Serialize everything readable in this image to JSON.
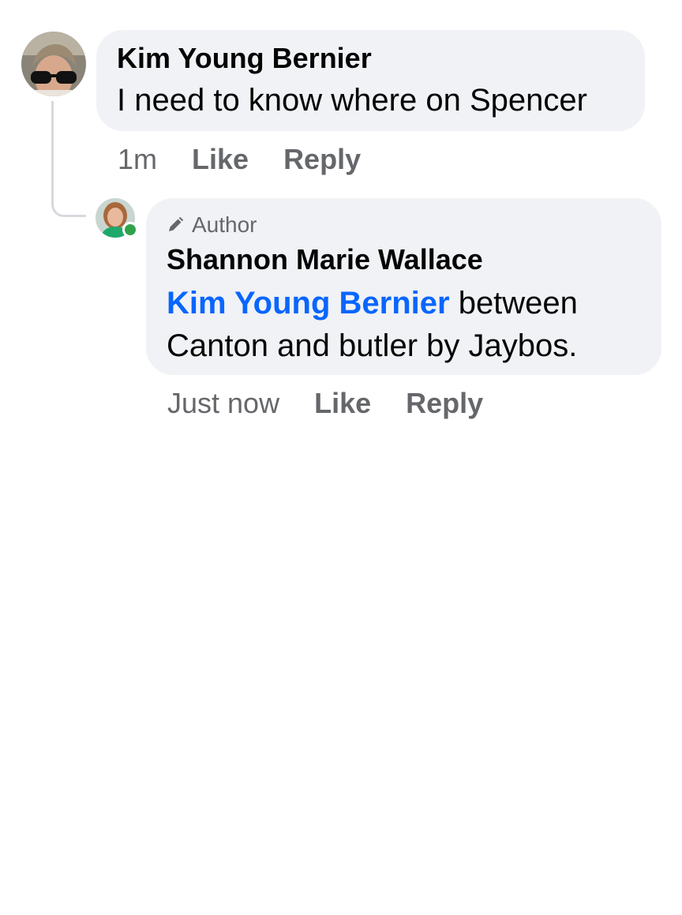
{
  "comments": [
    {
      "author": "Kim Young Bernier",
      "text": "I need to know where on Spencer",
      "timestamp": "1m",
      "like_label": "Like",
      "reply_label": "Reply",
      "avatar_icon": "profile-photo-sunglasses"
    }
  ],
  "reply": {
    "badge_label": "Author",
    "badge_icon": "pencil-icon",
    "author": "Shannon Marie Wallace",
    "mention": "Kim Young Bernier",
    "text": " between Canton and butler by Jaybos.",
    "timestamp": "Just now",
    "like_label": "Like",
    "reply_label": "Reply",
    "avatar_icon": "profile-photo",
    "online": true
  },
  "colors": {
    "bubble_bg": "#f0f2f5",
    "mention": "#0866ff",
    "secondary_text": "#65676b",
    "online": "#31a24c",
    "thread_line": "#d6d9dd"
  }
}
